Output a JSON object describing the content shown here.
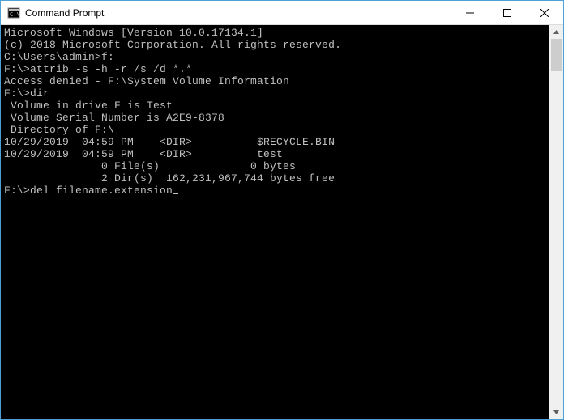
{
  "window": {
    "title": "Command Prompt"
  },
  "terminal": {
    "lines": [
      "Microsoft Windows [Version 10.0.17134.1]",
      "(c) 2018 Microsoft Corporation. All rights reserved.",
      "",
      "C:\\Users\\admin>f:",
      "",
      "F:\\>attrib -s -h -r /s /d *.*",
      "Access denied - F:\\System Volume Information",
      "",
      "F:\\>dir",
      " Volume in drive F is Test",
      " Volume Serial Number is A2E9-8378",
      "",
      " Directory of F:\\",
      "",
      "10/29/2019  04:59 PM    <DIR>          $RECYCLE.BIN",
      "10/29/2019  04:59 PM    <DIR>          test",
      "               0 File(s)              0 bytes",
      "               2 Dir(s)  162,231,967,744 bytes free",
      "",
      "F:\\>del filename.extension"
    ]
  }
}
